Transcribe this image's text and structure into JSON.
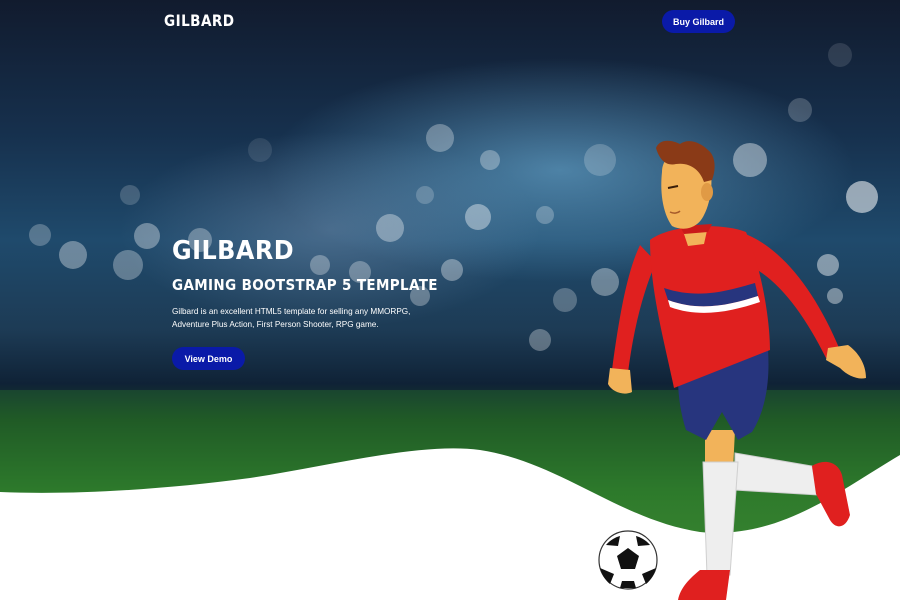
{
  "navbar": {
    "logo": "GILBARD",
    "buy_button": "Buy Gilbard"
  },
  "hero": {
    "title": "GILBARD",
    "subtitle": "GAMING BOOTSTRAP 5 TEMPLATE",
    "description_line1": "Gilbard is an excellent HTML5 template for selling any MMORPG,",
    "description_line2": "Adventure Plus Action, First Person Shooter, RPG game.",
    "demo_button": "View Demo"
  },
  "colors": {
    "button_blue": "#0a1aa8",
    "jersey_red": "#e0201f",
    "shorts_blue": "#27357e",
    "grass_green": "#3b8a31"
  }
}
